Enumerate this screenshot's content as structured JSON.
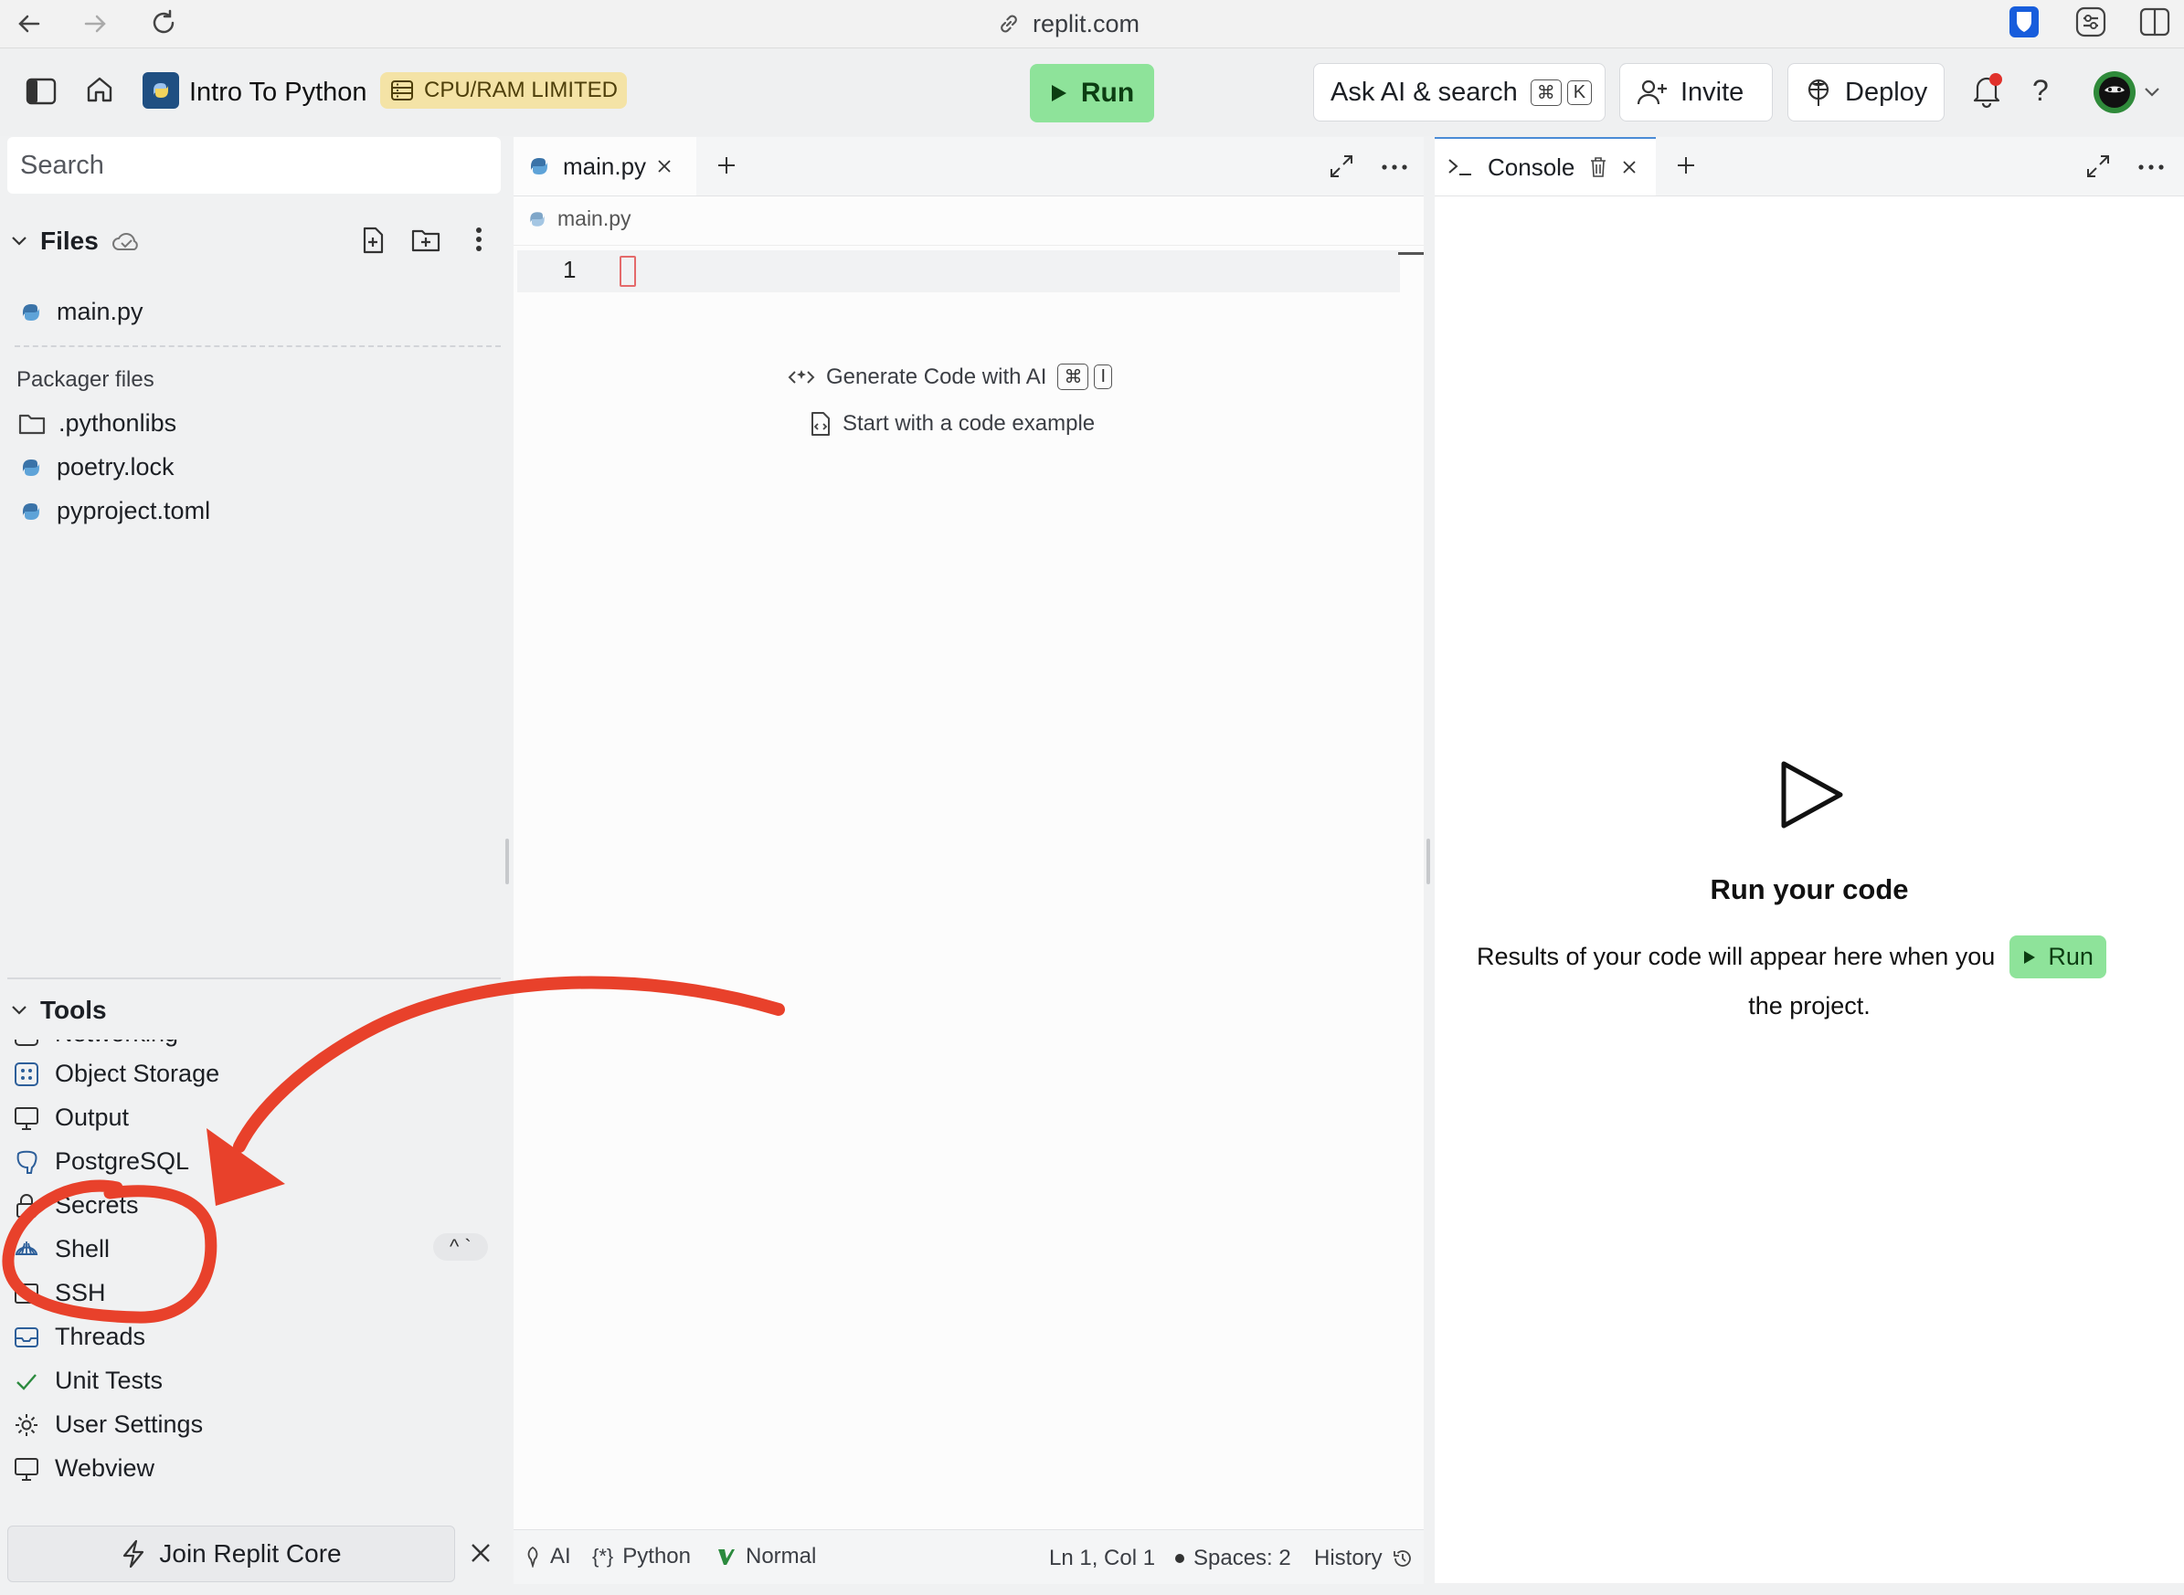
{
  "browser": {
    "url": "replit.com"
  },
  "header": {
    "project_title": "Intro To Python",
    "badge_label": "CPU/RAM LIMITED",
    "run_label": "Run",
    "search_label": "Ask AI & search",
    "search_shortcut": [
      "⌘",
      "K"
    ],
    "invite_label": "Invite",
    "deploy_label": "Deploy",
    "help_label": "?"
  },
  "sidebar": {
    "search_placeholder": "Search",
    "files_label": "Files",
    "files": [
      {
        "name": "main.py",
        "icon": "python-icon"
      }
    ],
    "packager_label": "Packager files",
    "packager_files": [
      {
        "name": ".pythonlibs",
        "icon": "folder-icon"
      },
      {
        "name": "poetry.lock",
        "icon": "python-icon"
      },
      {
        "name": "pyproject.toml",
        "icon": "python-icon"
      }
    ],
    "tools_label": "Tools",
    "tools": [
      {
        "name": "Networking",
        "icon": "network-icon"
      },
      {
        "name": "Object Storage",
        "icon": "storage-icon"
      },
      {
        "name": "Output",
        "icon": "monitor-icon"
      },
      {
        "name": "PostgreSQL",
        "icon": "postgres-icon"
      },
      {
        "name": "Secrets",
        "icon": "lock-icon"
      },
      {
        "name": "Shell",
        "icon": "shell-icon"
      },
      {
        "name": "SSH",
        "icon": "terminal-icon"
      },
      {
        "name": "Threads",
        "icon": "inbox-icon"
      },
      {
        "name": "Unit Tests",
        "icon": "check-icon"
      },
      {
        "name": "User Settings",
        "icon": "gear-icon"
      },
      {
        "name": "Webview",
        "icon": "monitor-icon"
      }
    ],
    "shell_shortcut": "^ `",
    "join_label": "Join Replit Core"
  },
  "editor": {
    "tab_label": "main.py",
    "breadcrumb": "main.py",
    "line_number": "1",
    "generate_label": "Generate Code with AI",
    "generate_shortcut": [
      "⌘",
      "I"
    ],
    "example_label": "Start with a code example",
    "status": {
      "ai": "AI",
      "language": "Python",
      "mode": "Normal",
      "cursor": "Ln 1, Col 1",
      "spaces": "Spaces: 2",
      "history": "History"
    }
  },
  "console": {
    "tab_label": "Console",
    "heading": "Run your code",
    "body_before": "Results of your code will appear here when you",
    "run_label": "Run",
    "body_after": "the project."
  },
  "colors": {
    "run_green": "#8ee39a",
    "badge_yellow": "#f4e3a6",
    "annotation_red": "#e8412b",
    "python_blue": "#3a73a8"
  }
}
